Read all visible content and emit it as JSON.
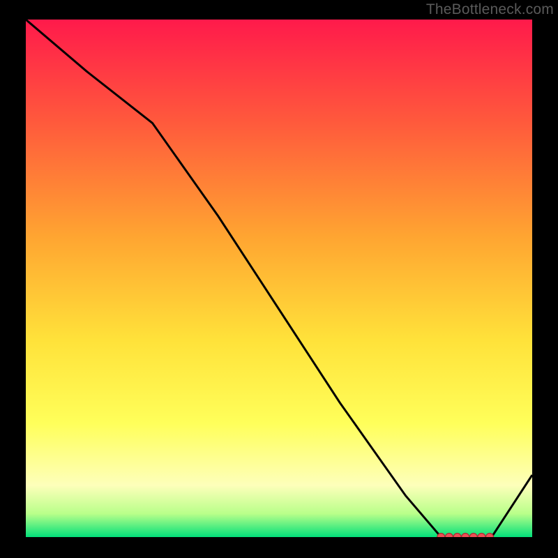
{
  "watermark": "TheBottleneck.com",
  "chart_data": {
    "type": "line",
    "title": "",
    "xlabel": "",
    "ylabel": "",
    "xlim": [
      0,
      100
    ],
    "ylim": [
      0,
      100
    ],
    "x": [
      0,
      12,
      25,
      38,
      50,
      62,
      75,
      82,
      85,
      88,
      92,
      100
    ],
    "values": [
      100,
      90,
      80,
      62,
      44,
      26,
      8,
      0,
      0,
      0,
      0,
      12
    ],
    "marker_x": [
      82.0,
      83.6,
      85.2,
      86.8,
      88.4,
      90.0,
      91.6
    ],
    "marker_y": [
      0,
      0,
      0,
      0,
      0,
      0,
      0
    ],
    "gradient_stops": [
      {
        "offset": 0.0,
        "color": "#ff1a4b"
      },
      {
        "offset": 0.2,
        "color": "#ff5a3c"
      },
      {
        "offset": 0.42,
        "color": "#ffa531"
      },
      {
        "offset": 0.62,
        "color": "#ffe23a"
      },
      {
        "offset": 0.78,
        "color": "#ffff5a"
      },
      {
        "offset": 0.9,
        "color": "#fdffba"
      },
      {
        "offset": 0.955,
        "color": "#b9ff8a"
      },
      {
        "offset": 1.0,
        "color": "#02e07a"
      }
    ]
  }
}
